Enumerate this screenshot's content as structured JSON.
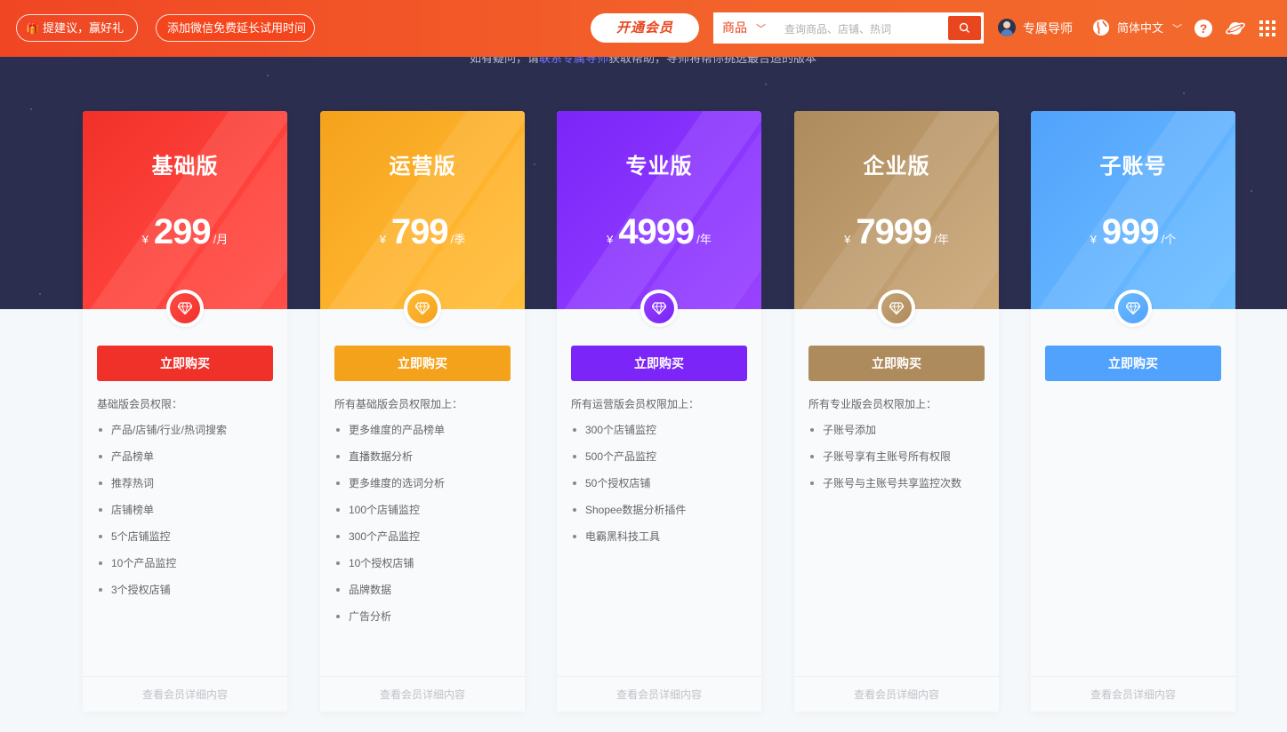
{
  "header": {
    "feedback_label": "提建议，赢好礼",
    "wechat_label": "添加微信免费延长试用时间",
    "vip_label": "开通会员",
    "search": {
      "category": "商品",
      "placeholder": "查询商品、店铺、热词"
    },
    "mentor_label": "专属导师",
    "language_label": "简体中文",
    "help_label": "?"
  },
  "hero": {
    "note_before": "如有疑问，请",
    "note_link": "联系专属导师",
    "note_after": "获取帮助，导师将帮你挑选最合适的版本"
  },
  "colors": {
    "header_accent": "#f15a28",
    "hero_bg": "#2b2e4e"
  },
  "plans": [
    {
      "title": "基础版",
      "currency": "¥",
      "price": "299",
      "unit": "/月",
      "buy_label": "立即购买",
      "perm_head": "基础版会员权限：",
      "perms": [
        "产品/店铺/行业/热词搜索",
        "产品榜单",
        "推荐热词",
        "店铺榜单",
        "5个店铺监控",
        "10个产品监控",
        "3个授权店铺"
      ],
      "footer": "查看会员详细内容",
      "color": "#f0312a"
    },
    {
      "title": "运营版",
      "currency": "¥",
      "price": "799",
      "unit": "/季",
      "buy_label": "立即购买",
      "perm_head": "所有基础版会员权限加上：",
      "perms": [
        "更多维度的产品榜单",
        "直播数据分析",
        "更多维度的选词分析",
        "100个店铺监控",
        "300个产品监控",
        "10个授权店铺",
        "品牌数据",
        "广告分析"
      ],
      "footer": "查看会员详细内容",
      "color": "#f4a21c"
    },
    {
      "title": "专业版",
      "currency": "¥",
      "price": "4999",
      "unit": "/年",
      "buy_label": "立即购买",
      "perm_head": "所有运营版会员权限加上：",
      "perms": [
        "300个店铺监控",
        "500个产品监控",
        "50个授权店铺",
        "Shopee数据分析插件",
        "电霸黑科技工具"
      ],
      "footer": "查看会员详细内容",
      "color": "#7b25f8"
    },
    {
      "title": "企业版",
      "currency": "¥",
      "price": "7999",
      "unit": "/年",
      "buy_label": "立即购买",
      "perm_head": "所有专业版会员权限加上：",
      "perms": [
        "子账号添加",
        "子账号享有主账号所有权限",
        "子账号与主账号共享监控次数"
      ],
      "footer": "查看会员详细内容",
      "color": "#ae8b5c"
    },
    {
      "title": "子账号",
      "currency": "¥",
      "price": "999",
      "unit": "/个",
      "buy_label": "立即购买",
      "perm_head": "",
      "perms": [],
      "footer": "查看会员详细内容",
      "color": "#51a2fc"
    }
  ]
}
